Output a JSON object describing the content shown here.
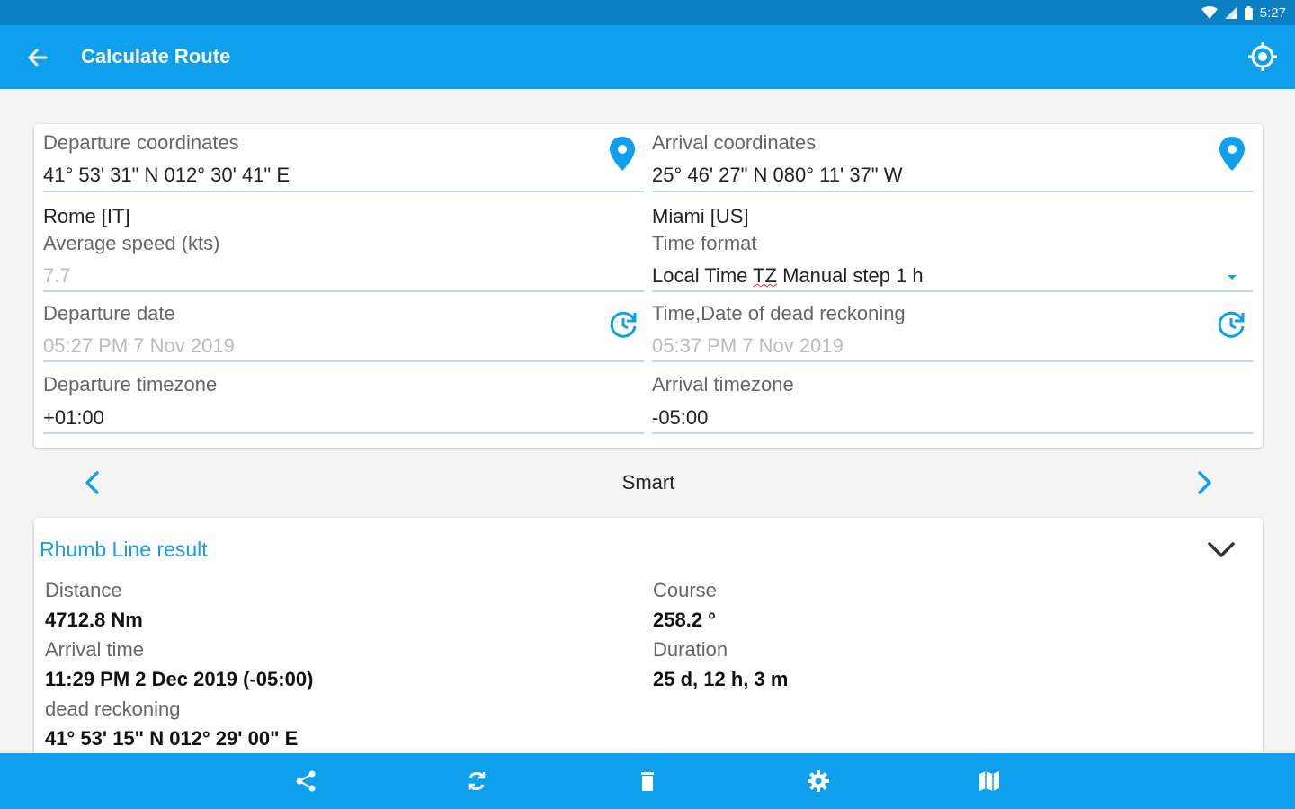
{
  "status_bar": {
    "time": "5:27"
  },
  "appbar": {
    "title": "Calculate Route"
  },
  "form": {
    "departure_coordinates": {
      "label": "Departure coordinates",
      "value": "41° 53' 31\" N 012° 30' 41\" E",
      "place": "Rome [IT]"
    },
    "arrival_coordinates": {
      "label": "Arrival coordinates",
      "value": "25° 46' 27\" N 080° 11' 37\" W",
      "place": "Miami [US]"
    },
    "average_speed": {
      "label": "Average speed (kts)",
      "placeholder": "7.7"
    },
    "time_format": {
      "label": "Time format",
      "value_pre": "Local Time ",
      "value_tz": "TZ",
      "value_post": " Manual step 1 h"
    },
    "departure_date": {
      "label": "Departure date",
      "placeholder": "05:27 PM 7 Nov 2019"
    },
    "dead_reckoning_time": {
      "label": "Time,Date of dead reckoning",
      "placeholder": "05:37 PM 7 Nov 2019"
    },
    "departure_timezone": {
      "label": "Departure timezone",
      "value": "+01:00"
    },
    "arrival_timezone": {
      "label": "Arrival timezone",
      "value": "-05:00"
    }
  },
  "mode_selector": {
    "label": "Smart"
  },
  "result": {
    "title": "Rhumb Line result",
    "distance": {
      "label": "Distance",
      "value": "4712.8 Nm"
    },
    "course": {
      "label": "Course",
      "value": "258.2 °"
    },
    "arrival_time": {
      "label": "Arrival time",
      "value": "11:29 PM 2 Dec 2019 (-05:00)"
    },
    "duration": {
      "label": "Duration",
      "value": "25 d, 12 h, 3 m"
    },
    "dead_reckoning": {
      "label": "dead reckoning",
      "value": "41° 53' 15\" N 012° 29' 00\" E"
    }
  },
  "bottom_bar": {
    "icons": [
      "share-icon",
      "refresh-icon",
      "delete-icon",
      "settings-icon",
      "map-icon"
    ]
  },
  "colors": {
    "status_bar": "#0a7fc4",
    "primary": "#0ea0ec",
    "accent": "#1a9de6",
    "underline": "#b9d9f0",
    "background": "#f4f4f4"
  }
}
